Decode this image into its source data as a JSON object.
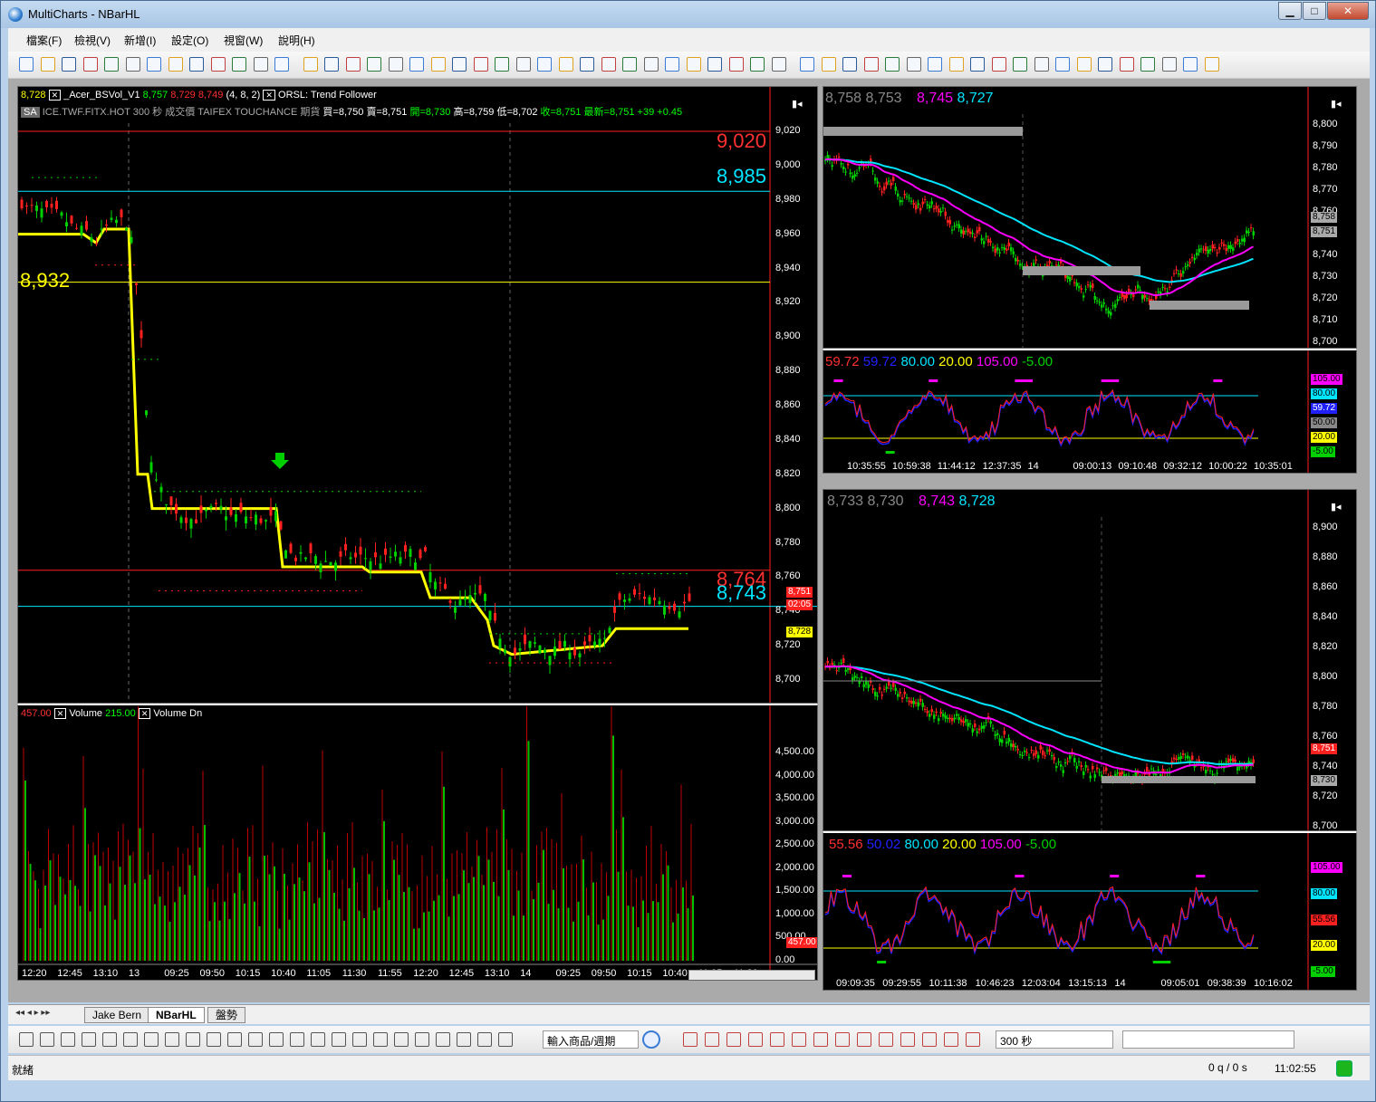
{
  "window": {
    "title": "MultiCharts - NBarHL",
    "min": "▁",
    "max": "□",
    "close": "✕"
  },
  "menu": [
    "檔案(F)",
    "檢視(V)",
    "新增(I)",
    "設定(O)",
    "視窗(W)",
    "說明(H)"
  ],
  "main_chart": {
    "price_now": "8,728",
    "study1_name": "_Acer_BSVol_V1",
    "study1_v1": "8,757",
    "study1_v2": "8,729",
    "study1_v3": "8,749",
    "study1_params": "(4, 8, 2)",
    "study2_name": "ORSL: Trend Follower",
    "sa_label": "SA",
    "symbol_line": "ICE.TWF.FITX.HOT   300 秒   成交價  TAIFEX  TOUCHANCE 期貨",
    "bid": "買=8,750",
    "ask": "賣=8,751",
    "open": "開=8,730",
    "high": "高=8,759",
    "low": "低=8,702",
    "close": "收=8,751",
    "last": "最新=8,751",
    "change": "+39",
    "pct": "+0.45",
    "levels": {
      "l1": "9,020",
      "l2": "8,985",
      "l3": "8,932",
      "l4": "8,764",
      "l5": "8,743"
    },
    "yaxis": [
      "9,020",
      "9,000",
      "8,980",
      "8,960",
      "8,940",
      "8,920",
      "8,900",
      "8,880",
      "8,860",
      "8,840",
      "8,820",
      "8,800",
      "8,780",
      "8,760",
      "8,740",
      "8,720",
      "8,700"
    ],
    "tags": {
      "last": "8,751",
      "time": "02:05",
      "yellow": "8,728"
    }
  },
  "volume": {
    "v1": "457.00",
    "name1": "Volume",
    "v2": "215.00",
    "name2": "Volume Dn",
    "yaxis": [
      "4,500.00",
      "4,000.00",
      "3,500.00",
      "3,000.00",
      "2,500.00",
      "2,000.00",
      "1,500.00",
      "1,000.00",
      "500.00",
      "0.00"
    ],
    "tag": "457.00",
    "xaxis": [
      "12:20",
      "12:45",
      "13:10",
      "13",
      "09:25",
      "09:50",
      "10:15",
      "10:40",
      "11:05",
      "11:30",
      "11:55",
      "12:20",
      "12:45",
      "13:10",
      "14",
      "09:25",
      "09:50",
      "10:15",
      "10:40",
      "11:05",
      "11:30"
    ]
  },
  "tr_chart": {
    "h1": "8,758",
    "h2": "8,753",
    "h3": "8,745",
    "h4": "8,727",
    "yaxis": [
      "8,800",
      "8,790",
      "8,780",
      "8,770",
      "8,760",
      "8,750",
      "8,740",
      "8,730",
      "8,720",
      "8,710",
      "8,700"
    ],
    "tags": [
      "8,758",
      "8,751"
    ],
    "osc": {
      "a": "59.72",
      "b": "59.72",
      "c": "80.00",
      "d": "20.00",
      "e": "105.00",
      "f": "-5.00"
    },
    "osc_tags": [
      "105.00",
      "80.00",
      "59.72",
      "50.00",
      "20.00",
      "-5.00"
    ],
    "xaxis": [
      "10:35:55",
      "10:59:38",
      "11:44:12",
      "12:37:35",
      "14",
      "09:00:13",
      "09:10:48",
      "09:32:12",
      "10:00:22",
      "10:35:01"
    ]
  },
  "br_chart": {
    "h1": "8,733",
    "h2": "8,730",
    "h3": "8,743",
    "h4": "8,728",
    "yaxis": [
      "8,900",
      "8,880",
      "8,860",
      "8,840",
      "8,820",
      "8,800",
      "8,780",
      "8,760",
      "8,740",
      "8,720",
      "8,700"
    ],
    "tags": [
      "8,751",
      "8,730"
    ],
    "osc": {
      "a": "55.56",
      "b": "50.02",
      "c": "80.00",
      "d": "20.00",
      "e": "105.00",
      "f": "-5.00"
    },
    "osc_tags": [
      "105.00",
      "80.00",
      "55.56",
      "20.00",
      "-5.00"
    ],
    "xaxis": [
      "09:09:35",
      "09:29:55",
      "10:11:38",
      "10:46:23",
      "12:03:04",
      "13:15:13",
      "14",
      "09:05:01",
      "09:38:39",
      "10:16:02"
    ]
  },
  "tabs": [
    "Jake Bern",
    "NBarHL",
    "盤勢"
  ],
  "drawbar": {
    "symbol_placeholder": "輸入商品/週期",
    "interval": "300 秒"
  },
  "status": {
    "text": "就緒",
    "queue": "0 q / 0 s",
    "time": "11:02:55"
  },
  "colors": {
    "up": "#00c000",
    "down": "#ff2020",
    "yellow": "#ffff00",
    "cyan": "#00e5ff",
    "magenta": "#ff00ff",
    "red": "#ff3030"
  }
}
